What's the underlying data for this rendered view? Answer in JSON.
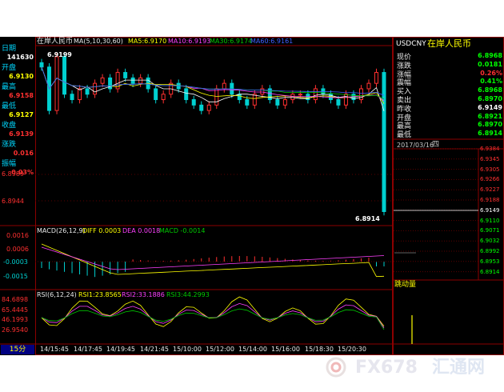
{
  "main_header": {
    "name": "在岸人民币",
    "ma_prefix": "MA(5,10,30,60)",
    "ma5": "MA5:6.9170",
    "ma10": "MA10:6.9193",
    "ma30": "MA30:6.9174",
    "ma60": "MA60:6.9161"
  },
  "left_panel": [
    {
      "label": "日期",
      "value": "141630",
      "label_color": "#00d8ff",
      "value_color": "#ffffff"
    },
    {
      "label": "开盘",
      "value": "6.9130",
      "label_color": "#00d8ff",
      "value_color": "#ffff00"
    },
    {
      "label": "最高",
      "value": "6.9158",
      "label_color": "#00d8ff",
      "value_color": "#ff3030"
    },
    {
      "label": "最低",
      "value": "6.9127",
      "label_color": "#00d8ff",
      "value_color": "#ffff00"
    },
    {
      "label": "收盘",
      "value": "6.9139",
      "label_color": "#00d8ff",
      "value_color": "#ff3030"
    },
    {
      "label": "涨跌",
      "value": "0.016",
      "label_color": "#00d8ff",
      "value_color": "#ff3030"
    },
    {
      "label": "振幅",
      "value": "0.03%",
      "label_color": "#00d8ff",
      "value_color": "#ff3030"
    }
  ],
  "price_axis": [
    "6.8989",
    "6.8944"
  ],
  "hi_label": "6.9199",
  "lo_label": "6.8914",
  "macd_header": {
    "name": "MACD(26,12,9)",
    "diff": "DIFF 0.0003",
    "dea": "DEA 0.0018",
    "macd": "MACD -0.0014"
  },
  "macd_axis": [
    "0.0016",
    "0.0006",
    "-0.0003",
    "-0.0015"
  ],
  "rsi_header": {
    "name": "RSI(6,12,24)",
    "rsi1": "RSI1:23.8565",
    "rsi2": "RSI2:33.1886",
    "rsi3": "RSI3:44.2993"
  },
  "rsi_axis": [
    "84.6898",
    "65.4445",
    "46.1993",
    "26.9540"
  ],
  "period_tab": "15分",
  "time_axis": [
    "14/15:45",
    "14/17:45",
    "14/19:45",
    "14/21:45",
    "15/10:00",
    "15/12:00",
    "15/14:00",
    "15/16:00",
    "15/18:30",
    "15/20:30"
  ],
  "quote": {
    "symbol": "USDCNY",
    "name": "在岸人民币",
    "rows": [
      {
        "label": "现价",
        "value": "6.8968",
        "color": "#00ff00"
      },
      {
        "label": "涨跌",
        "value": "0.0181",
        "color": "#00ff00"
      },
      {
        "label": "涨幅",
        "value": "0.26%",
        "color": "#ff3030"
      },
      {
        "label": "震幅",
        "value": "0.41%",
        "color": "#00ff00"
      },
      {
        "label": "买入",
        "value": "6.8968",
        "color": "#00ff00"
      },
      {
        "label": "卖出",
        "value": "6.8970",
        "color": "#00ff00"
      },
      {
        "label": "昨收",
        "value": "6.9149",
        "color": "#ffffff"
      },
      {
        "label": "开盘",
        "value": "6.8921",
        "color": "#00ff00"
      },
      {
        "label": "最高",
        "value": "6.8970",
        "color": "#00ff00"
      },
      {
        "label": "最低",
        "value": "6.8914",
        "color": "#00ff00"
      }
    ],
    "date": "2017/03/16",
    "weekday": "四"
  },
  "mini_axis": [
    {
      "v": "6.9384",
      "c": "#ff3030"
    },
    {
      "v": "6.9345",
      "c": "#ff3030"
    },
    {
      "v": "6.9305",
      "c": "#ff3030"
    },
    {
      "v": "6.9266",
      "c": "#ff3030"
    },
    {
      "v": "6.9227",
      "c": "#ff3030"
    },
    {
      "v": "6.9188",
      "c": "#ff3030"
    },
    {
      "v": "6.9149",
      "c": "#ffffff"
    },
    {
      "v": "6.9110",
      "c": "#00ff00"
    },
    {
      "v": "6.9071",
      "c": "#00ff00"
    },
    {
      "v": "6.9032",
      "c": "#00ff00"
    },
    {
      "v": "6.8992",
      "c": "#00ff00"
    },
    {
      "v": "6.8953",
      "c": "#00ff00"
    },
    {
      "v": "6.8914",
      "c": "#00ff00"
    }
  ],
  "volume_label": "跳动量",
  "watermark": {
    "brand": "FX678",
    "cn": "汇通网"
  },
  "colors": {
    "up": "#ff3030",
    "down": "#00d0d0",
    "ma5": "#ffffff",
    "ma10": "#ffff00",
    "ma30": "#ff40ff",
    "ma60": "#00c800",
    "ma_extra": "#4060ff",
    "grid": "#8b0000",
    "axis_red": "#ff3030"
  },
  "chart_data": {
    "type": "candlestick",
    "interval": "15分",
    "candles_close_estimate": [
      6.918,
      6.91,
      6.9199,
      6.913,
      6.912,
      6.914,
      6.913,
      6.915,
      6.916,
      6.914,
      6.917,
      6.916,
      6.915,
      6.916,
      6.914,
      6.912,
      6.913,
      6.915,
      6.914,
      6.912,
      6.911,
      6.91,
      6.911,
      6.914,
      6.915,
      6.913,
      6.912,
      6.911,
      6.913,
      6.914,
      6.912,
      6.911,
      6.912,
      6.913,
      6.913,
      6.912,
      6.914,
      6.913,
      6.912,
      6.911,
      6.913,
      6.912,
      6.914,
      6.915,
      6.917,
      6.8914
    ],
    "macd": {
      "diff": 0.0003,
      "dea": 0.0018,
      "macd": -0.0014
    },
    "rsi": {
      "rsi1": 23.8565,
      "rsi2": 33.1886,
      "rsi3": 44.2993
    }
  }
}
